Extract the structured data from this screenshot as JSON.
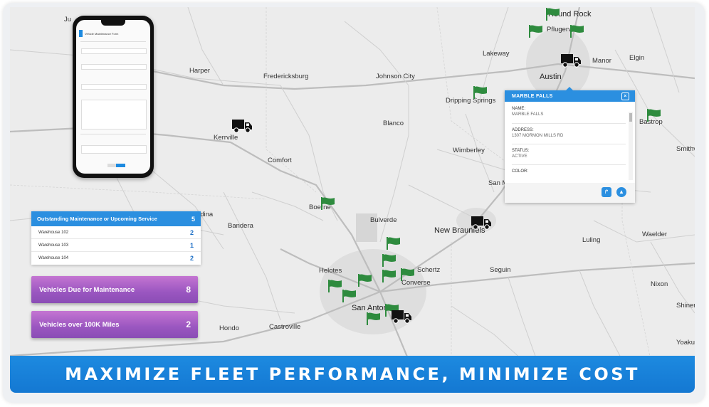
{
  "map": {
    "towns": [
      {
        "name": "Round Rock",
        "big": true
      },
      {
        "name": "Pflugerville"
      },
      {
        "name": "Lakeway"
      },
      {
        "name": "Elgin"
      },
      {
        "name": "Austin",
        "big": true
      },
      {
        "name": "Manor"
      },
      {
        "name": "Harper"
      },
      {
        "name": "Fredericksburg"
      },
      {
        "name": "Johnson City"
      },
      {
        "name": "Dripping Springs"
      },
      {
        "name": "Bastrop"
      },
      {
        "name": "Kerrville"
      },
      {
        "name": "Blanco"
      },
      {
        "name": "Smithvi"
      },
      {
        "name": "Comfort"
      },
      {
        "name": "Wimberley"
      },
      {
        "name": "San M"
      },
      {
        "name": "Medina"
      },
      {
        "name": "Boerne"
      },
      {
        "name": "Bandera"
      },
      {
        "name": "Bulverde"
      },
      {
        "name": "New Braunfels",
        "big": true
      },
      {
        "name": "Waelder"
      },
      {
        "name": "Luling"
      },
      {
        "name": "Helotes"
      },
      {
        "name": "Schertz"
      },
      {
        "name": "Seguin"
      },
      {
        "name": "Converse"
      },
      {
        "name": "Nixon"
      },
      {
        "name": "Shiner"
      },
      {
        "name": "Hondo"
      },
      {
        "name": "Castroville"
      },
      {
        "name": "San Antonio",
        "big": true
      },
      {
        "name": "Yoaku"
      },
      {
        "name": "Ju"
      }
    ],
    "flag_icon": "flag-icon",
    "truck_icon": "truck-icon",
    "flag_color": "#2e8b3e",
    "truck_color": "#111111"
  },
  "phone": {
    "title": "Vehicle Maintenance Form",
    "save_label": "Save"
  },
  "popup": {
    "title": "MARBLE FALLS",
    "fields": [
      {
        "label": "NAME:",
        "value": "MARBLE FALLS"
      },
      {
        "label": "ADDRESS:",
        "value": "1307 MORMON MILLS RD"
      },
      {
        "label": "STATUS:",
        "value": "ACTIVE"
      },
      {
        "label": "COLOR:",
        "value": ""
      }
    ],
    "accent": "#2b8fe0"
  },
  "maintenance": {
    "title": "Outstanding Maintenance or Upcoming Service",
    "count": "5",
    "rows": [
      {
        "name": "Warehouse 102",
        "count": "2"
      },
      {
        "name": "Warehouse 103",
        "count": "1"
      },
      {
        "name": "Warehouse 104",
        "count": "2"
      }
    ]
  },
  "cards": [
    {
      "label": "Vehicles Due for Maintenance",
      "count": "8"
    },
    {
      "label": "Vehicles over 100K Miles",
      "count": "2"
    }
  ],
  "banner": {
    "text": "MAXIMIZE FLEET PERFORMANCE, MINIMIZE COST",
    "color": "#1d8ae0"
  }
}
